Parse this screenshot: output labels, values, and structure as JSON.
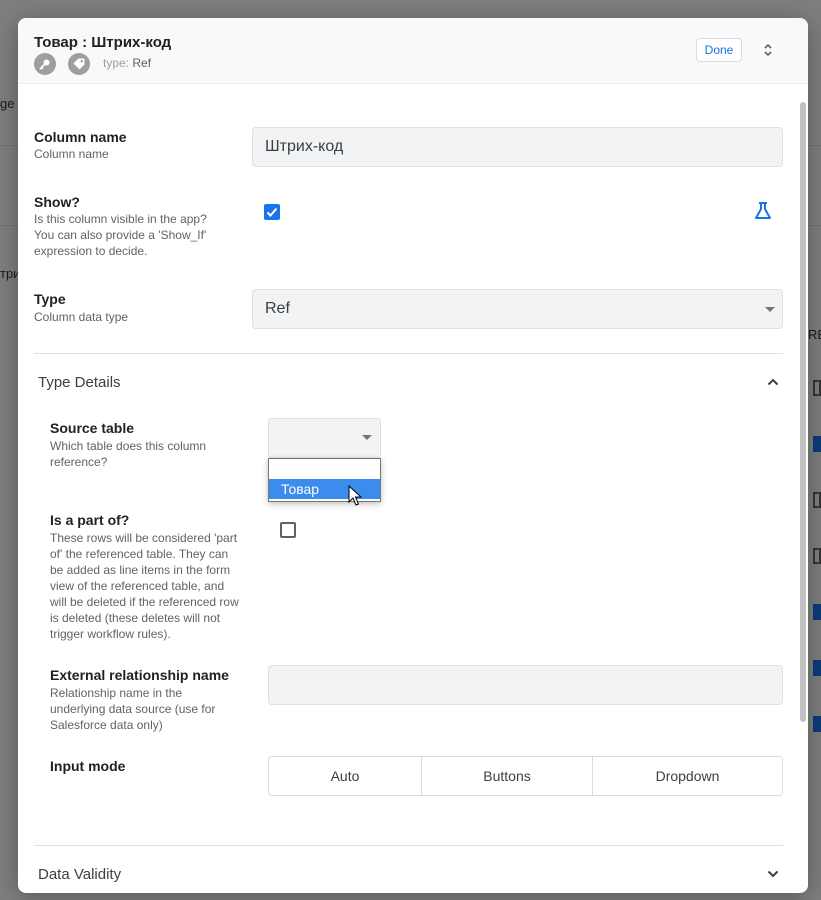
{
  "background": {
    "left_fragments": [
      "ge",
      "три"
    ],
    "right_fragment": "RE",
    "marker_color_blue": "#1a73e8",
    "marker_color_gray": "#9e9e9e"
  },
  "header": {
    "title": "Товар : Штрих-код",
    "type_prefix": "type:",
    "type_value": "Ref",
    "done_label": "Done",
    "icons": [
      "key-icon",
      "tag-icon",
      "unfold-icon"
    ]
  },
  "fields": {
    "column_name": {
      "label": "Column name",
      "description": "Column name",
      "value": "Штрих-код"
    },
    "show": {
      "label": "Show?",
      "description_lines": [
        "Is this column visible in the app?",
        "You can also provide a 'Show_If'",
        "expression to decide."
      ],
      "checked": true,
      "formula_icon": "flask-icon"
    },
    "type": {
      "label": "Type",
      "description": "Column data type",
      "value": "Ref"
    }
  },
  "type_details": {
    "title": "Type Details",
    "source_table": {
      "label": "Source table",
      "description_lines": [
        "Which table does this column",
        "reference?"
      ],
      "options": [
        "",
        "Товар"
      ],
      "highlighted": "Товар"
    },
    "is_part_of": {
      "label": "Is a part of?",
      "description_lines": [
        "These rows will be considered 'part",
        "of' the referenced table. They can",
        "be added as line items in the form",
        "view of the referenced table, and",
        "will be deleted if the referenced row",
        "is deleted (these deletes will not",
        "trigger workflow rules)."
      ],
      "checked": false
    },
    "external_relationship": {
      "label": "External relationship name",
      "description_lines": [
        "Relationship name in the",
        "underlying data source (use for",
        "Salesforce data only)"
      ],
      "value": ""
    },
    "input_mode": {
      "label": "Input mode",
      "options": [
        "Auto",
        "Buttons",
        "Dropdown"
      ]
    }
  },
  "data_validity": {
    "title": "Data Validity"
  },
  "colors": {
    "accent": "#1a73e8",
    "highlight": "#3b8ced"
  }
}
